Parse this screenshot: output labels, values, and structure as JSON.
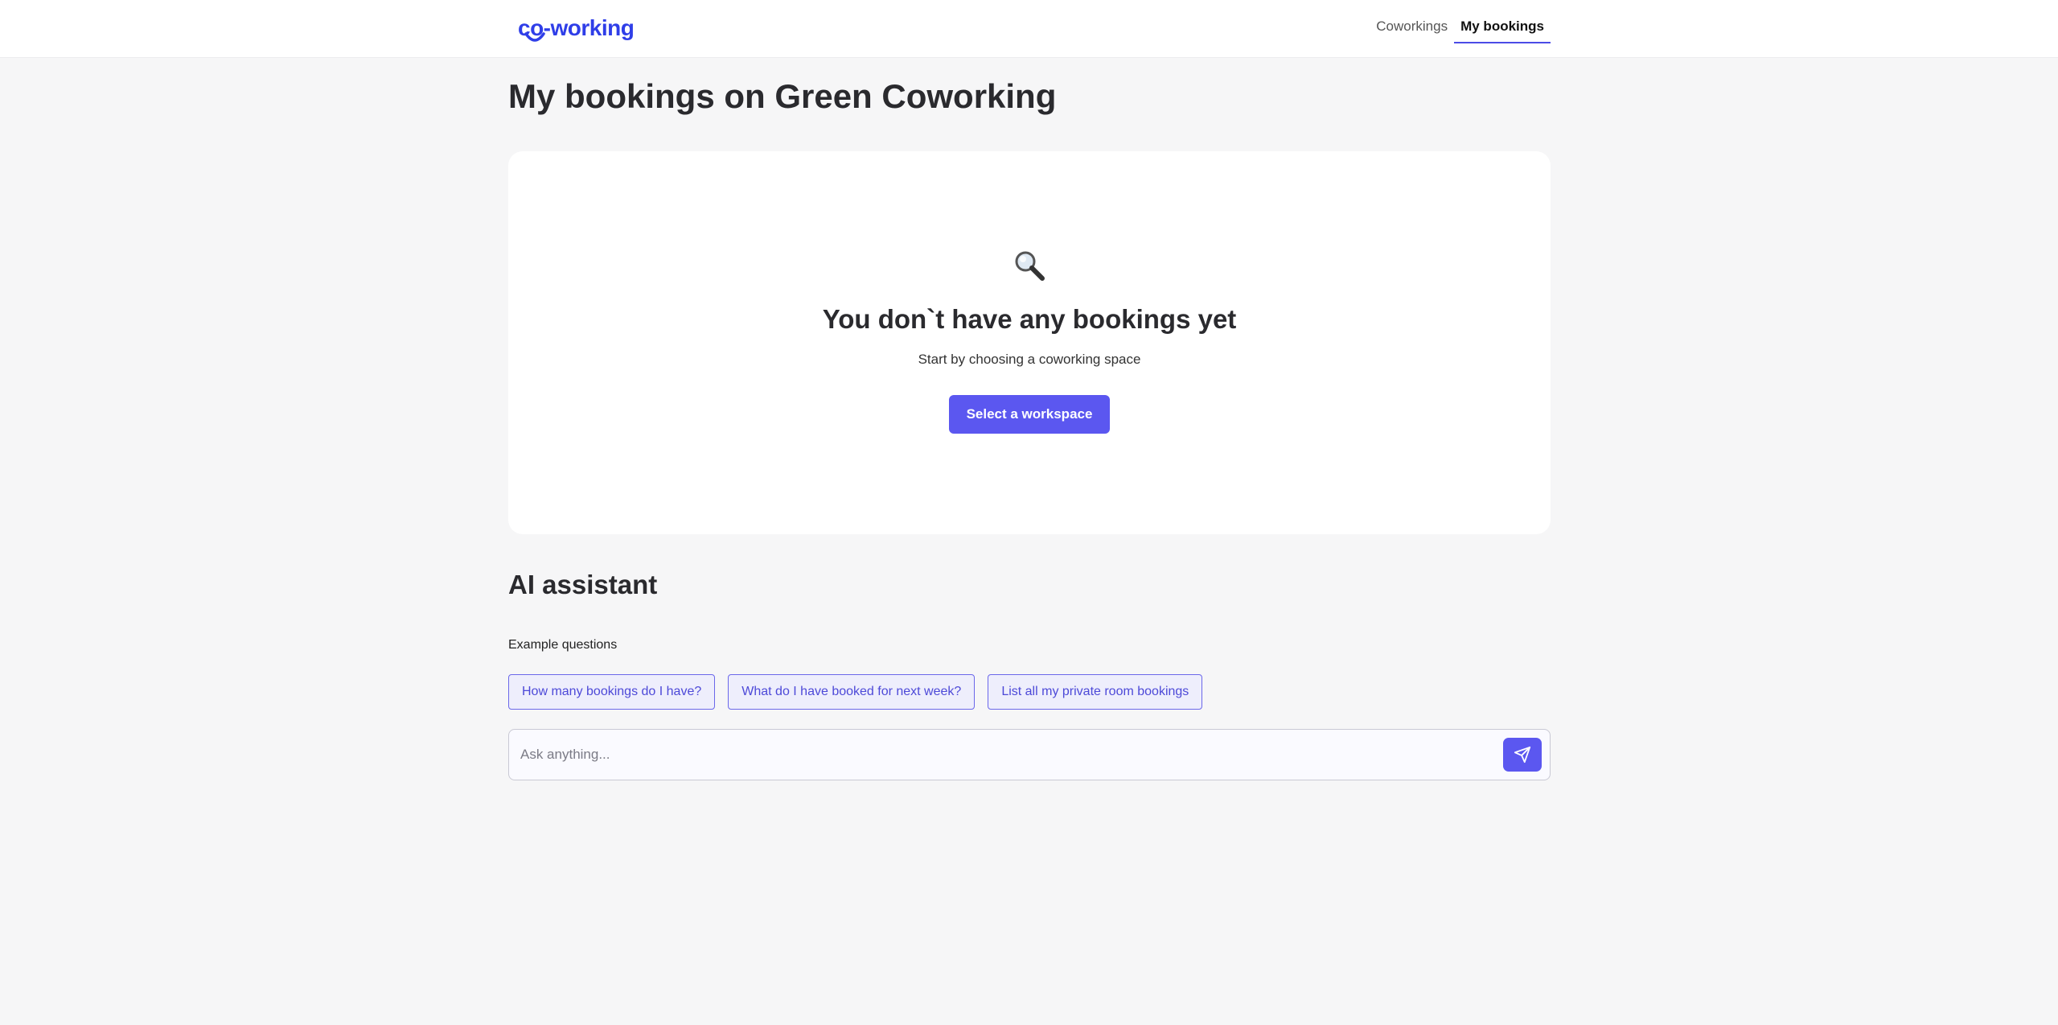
{
  "header": {
    "logo_text": "co-working",
    "nav": [
      {
        "label": "Coworkings",
        "active": false
      },
      {
        "label": "My bookings",
        "active": true
      }
    ],
    "accent_color": "#4b4ce6"
  },
  "main": {
    "page_title": "My bookings on Green Coworking",
    "empty_state": {
      "icon": "magnifier-icon",
      "title": "You don`t have any bookings yet",
      "subtitle": "Start by choosing a coworking space",
      "button_label": "Select a workspace"
    }
  },
  "assistant": {
    "title": "AI assistant",
    "examples_label": "Example questions",
    "examples": [
      "How many bookings do I have?",
      "What do I have booked for next week?",
      "List all my private room bookings"
    ],
    "input_placeholder": "Ask anything...",
    "send_icon": "send-icon"
  },
  "colors": {
    "brand": "#2f3ee8",
    "button": "#5b57f0",
    "background": "#f6f6f7"
  }
}
